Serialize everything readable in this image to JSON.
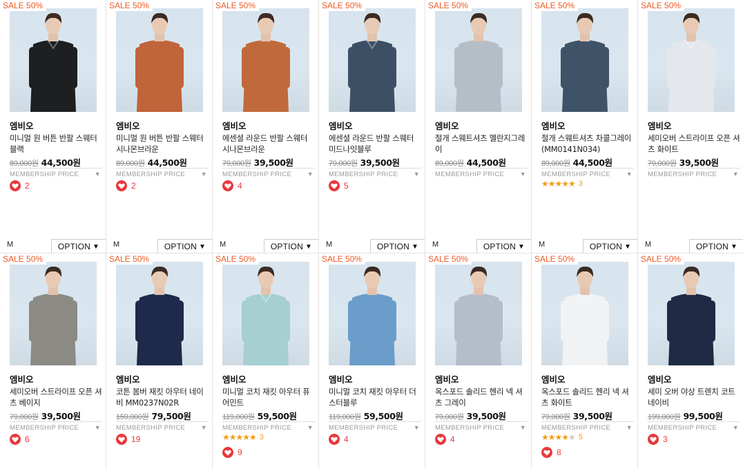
{
  "membership_label": "MEMBERSHIP PRICE",
  "size_label": "M",
  "option_label": "OPTION",
  "colors": {
    "sale": "#ee5a24",
    "heart": "#e8383d",
    "star": "#f39c12"
  },
  "products": [
    {
      "badge": "SALE 50%",
      "brand": "엠비오",
      "name": "미니멀 원 버튼 반팔 스웨터 블랙",
      "original_price": "89,000원",
      "price": "44,500원",
      "likes": "2",
      "rating": null,
      "garment": "#1d1f20",
      "pants": "#8a8a80"
    },
    {
      "badge": "SALE 50%",
      "brand": "엠비오",
      "name": "미니멀 원 버튼 반팔 스웨터 시나몬브라운",
      "original_price": "89,000원",
      "price": "44,500원",
      "likes": "2",
      "rating": null,
      "garment": "#c0643a",
      "pants": "#1c1c1e"
    },
    {
      "badge": "SALE 50%",
      "brand": "엠비오",
      "name": "에센셜 라운드 반팔 스웨터 시나몬브라운",
      "original_price": "79,000원",
      "price": "39,500원",
      "likes": "4",
      "rating": null,
      "garment": "#c06a3c",
      "pants": "#2a2a2c"
    },
    {
      "badge": "SALE 50%",
      "brand": "엠비오",
      "name": "에센셜 라운드 반팔 스웨터 미드나잇블루",
      "original_price": "79,000원",
      "price": "39,500원",
      "likes": "5",
      "rating": null,
      "garment": "#3c4f64",
      "pants": "#2a2a2c"
    },
    {
      "badge": "SALE 50%",
      "brand": "엠비오",
      "name": "절개 스웨트셔츠 멜란지그레이",
      "original_price": "89,000원",
      "price": "44,500원",
      "likes": "",
      "rating": null,
      "garment": "#b5bec6",
      "pants": "#1c1c1e"
    },
    {
      "badge": "SALE 50%",
      "brand": "엠비오",
      "name": "절개 스웨트셔츠 차콜그레이 (MM0141N034)",
      "original_price": "89,000원",
      "price": "44,500원",
      "likes": "",
      "rating": {
        "stars": 5,
        "count": "3"
      },
      "garment": "#3f5368",
      "pants": "#1c1c1e"
    },
    {
      "badge": "SALE 50%",
      "brand": "엠비오",
      "name": "세미오버 스트라이프 오픈 셔츠 화이트",
      "original_price": "79,000원",
      "price": "39,500원",
      "likes": "",
      "rating": null,
      "garment": "#e4e8ec",
      "pants": "#1c1c1e"
    },
    {
      "badge": "SALE 50%",
      "brand": "엠비오",
      "name": "세미오버 스트라이프 오픈 셔츠 베이지",
      "original_price": "79,000원",
      "price": "39,500원",
      "likes": "6",
      "rating": null,
      "garment": "#8b8a84",
      "pants": "#1c1c1e"
    },
    {
      "badge": "SALE 50%",
      "brand": "엠비오",
      "name": "코튼 봄버 재킷 아우터 네이비 MM0237N02R",
      "original_price": "159,000원",
      "price": "79,500원",
      "likes": "19",
      "rating": null,
      "garment": "#1e2a4a",
      "pants": "#2a3550"
    },
    {
      "badge": "SALE 50%",
      "brand": "엠비오",
      "name": "미니멀 코치 재킷 아우터 퓨어민트",
      "original_price": "119,000원",
      "price": "59,500원",
      "likes": "9",
      "rating": {
        "stars": 5,
        "count": "3"
      },
      "garment": "#a6cfd2",
      "pants": "#1c1c1e"
    },
    {
      "badge": "SALE 50%",
      "brand": "엠비오",
      "name": "미니멀 코치 재킷 아우터 더스터블루",
      "original_price": "119,000원",
      "price": "59,500원",
      "likes": "4",
      "rating": null,
      "garment": "#6a9dc9",
      "pants": "#3c5a80"
    },
    {
      "badge": "SALE 50%",
      "brand": "엠비오",
      "name": "옥스포드 솔리드 헨리 넥 셔츠 그레이",
      "original_price": "79,000원",
      "price": "39,500원",
      "likes": "4",
      "rating": null,
      "garment": "#b4bdc8",
      "pants": "#9aa4b0"
    },
    {
      "badge": "SALE 50%",
      "brand": "엠비오",
      "name": "옥스포드 솔리드 헨리 넥 셔츠 화이트",
      "original_price": "79,000원",
      "price": "39,500원",
      "likes": "8",
      "rating": {
        "stars": 4,
        "count": "5"
      },
      "garment": "#f0f2f4",
      "pants": "#1c1c1e"
    },
    {
      "badge": "SALE 50%",
      "brand": "엠비오",
      "name": "세미 오버 야상 트렌치 코트 네이비",
      "original_price": "199,000원",
      "price": "99,500원",
      "likes": "3",
      "rating": null,
      "garment": "#1f2b44",
      "pants": "#1c1c1e"
    }
  ]
}
